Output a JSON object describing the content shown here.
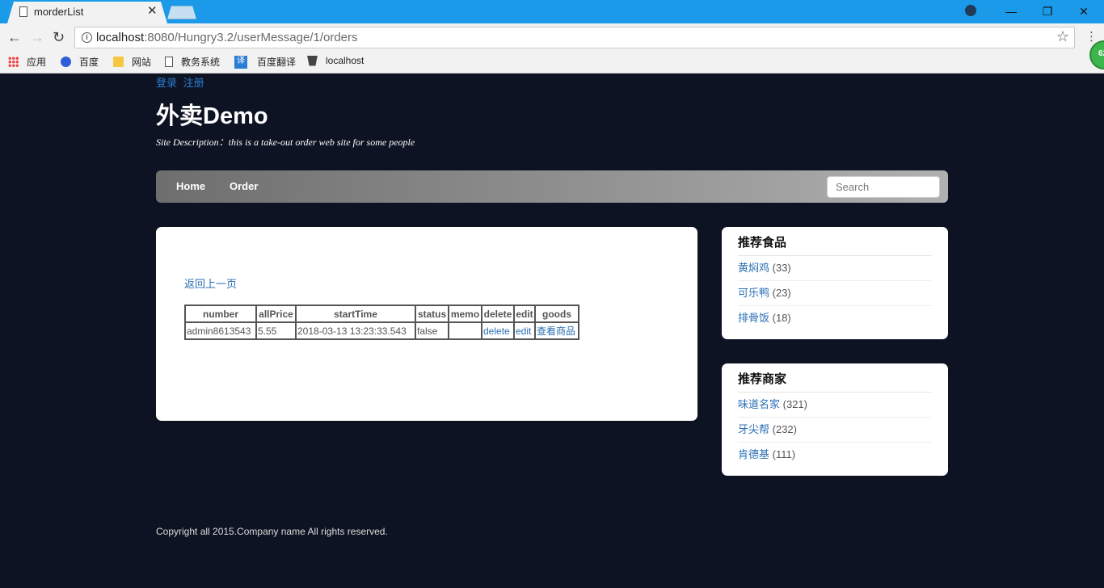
{
  "browser": {
    "tab_title": "morderList",
    "url_host": "localhost",
    "url_rest": ":8080/Hungry3.2/userMessage/1/orders",
    "bookmarks": [
      "应用",
      "百度",
      "网站",
      "教务系统",
      "百度翻译",
      "localhost"
    ],
    "extension_badge": "62"
  },
  "header": {
    "login": "登录",
    "register": "注册",
    "title": "外卖Demo",
    "description": "Site Description：this is a take-out order web site for some people"
  },
  "nav": {
    "home": "Home",
    "order": "Order",
    "search_placeholder": "Search"
  },
  "main": {
    "back_link": "返回上一页",
    "table": {
      "headers": [
        "number",
        "allPrice",
        "startTime",
        "status",
        "memo",
        "delete",
        "edit",
        "goods"
      ],
      "rows": [
        {
          "number": "admin8613543",
          "allPrice": "5.55",
          "startTime": "2018-03-13 13:23:33.543",
          "status": "false",
          "memo": "",
          "delete": "delete",
          "edit": "edit",
          "goods": "查看商品"
        }
      ]
    }
  },
  "sidebar": {
    "foods": {
      "title": "推荐食品",
      "items": [
        {
          "name": "黄焖鸡",
          "count": "(33)"
        },
        {
          "name": "可乐鸭",
          "count": "(23)"
        },
        {
          "name": "排骨饭",
          "count": "(18)"
        }
      ]
    },
    "shops": {
      "title": "推荐商家",
      "items": [
        {
          "name": "味道名家",
          "count": "(321)"
        },
        {
          "name": "牙尖帮",
          "count": "(232)"
        },
        {
          "name": "肯德基",
          "count": "(111)"
        }
      ]
    }
  },
  "footer": {
    "copyright": "Copyright all 2015.Company name All rights reserved."
  }
}
